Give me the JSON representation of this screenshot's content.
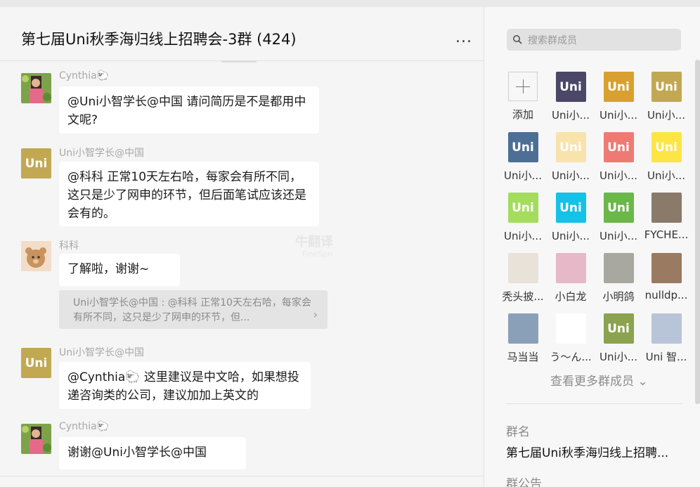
{
  "chat": {
    "title": "第七届Uni秋季海归线上招聘会-3群 (424)",
    "more_label": "...",
    "watermark": "牛翻译",
    "watermark_sub": "FineSpn",
    "messages": [
      {
        "sender": "Cynthia🐑",
        "text": "@Uni小智学长@中国 请问简历是不是都用中文呢?"
      },
      {
        "sender": "Uni小智学长@中国",
        "text": "@科科 正常10天左右哈，每家会有所不同，这只是少了网申的环节，但后面笔试应该还是会有的。"
      },
      {
        "sender": "科科",
        "text": "了解啦，谢谢~",
        "quote": "Uni小智学长@中国 : @科科 正常10天左右哈，每家会有所不同，这只是少了网申的环节，但..."
      },
      {
        "sender": "Uni小智学长@中国",
        "text": "@Cynthia🐑 这里建议是中文哈，如果想投递咨询类的公司，建议加加上英文的"
      },
      {
        "sender": "Cynthia🐑",
        "text": "谢谢@Uni小智学长@中国"
      }
    ]
  },
  "panel": {
    "search_placeholder": "搜索群成员",
    "members": [
      {
        "name": "添加",
        "kind": "add"
      },
      {
        "name": "Uni小...",
        "color": "#4a4767"
      },
      {
        "name": "Uni小...",
        "color": "#d8a12f"
      },
      {
        "name": "Uni小...",
        "color": "#c2a853"
      },
      {
        "name": "Uni小...",
        "color": "#4d6f95"
      },
      {
        "name": "Uni小...",
        "color": "#f8e3ad"
      },
      {
        "name": "Uni小...",
        "color": "#ef7a73"
      },
      {
        "name": "Uni小...",
        "color": "#fde545"
      },
      {
        "name": "Uni小...",
        "color": "#a4dc5d"
      },
      {
        "name": "Uni小...",
        "color": "#13c2e6"
      },
      {
        "name": "Uni小...",
        "color": "#6ab74a"
      },
      {
        "name": "FYCHE...",
        "color": "#8a7a6a"
      },
      {
        "name": "秃头披...",
        "color": "#e8e2d8"
      },
      {
        "name": "小白龙",
        "color": "#e6b8c8"
      },
      {
        "name": "小明鸽",
        "color": "#a8a8a0"
      },
      {
        "name": "nulldp...",
        "color": "#9a7a60"
      },
      {
        "name": "马当当",
        "color": "#8aa0b8"
      },
      {
        "name": "う～ん...",
        "color": "#ffffff"
      },
      {
        "name": "Uni小...",
        "color": "#8ba24f"
      },
      {
        "name": "Uni 智...",
        "color": "#b8c4d8"
      }
    ],
    "view_more": "查看更多群成员 ⌄",
    "group_name_label": "群名",
    "group_name_value": "第七届Uni秋季海归线上招聘...",
    "announcement_label": "群公告"
  },
  "colors": {
    "uni_gold": "#c2a853",
    "bubble": "#ffffff",
    "quote_bg": "#e4e4e4"
  }
}
